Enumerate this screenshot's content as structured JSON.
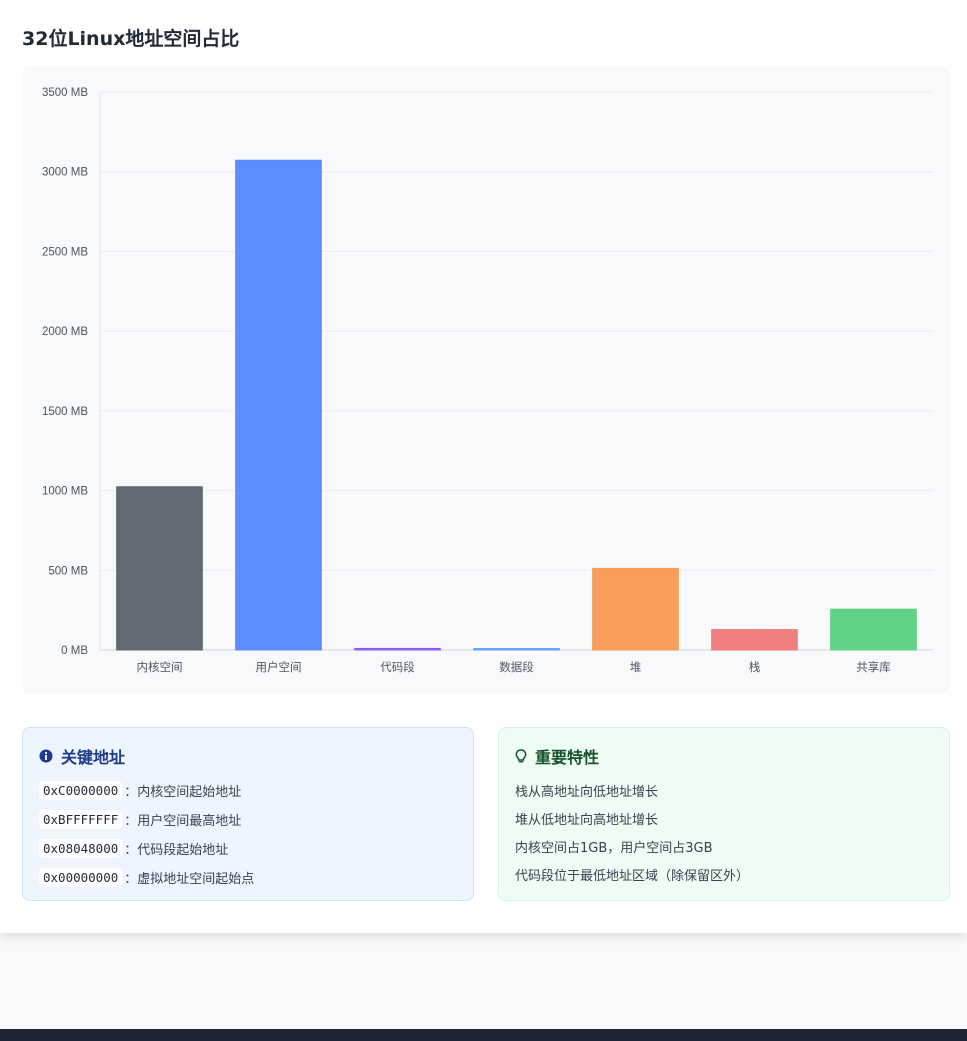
{
  "page": {
    "title": "32位Linux地址空间占比"
  },
  "chart_data": {
    "type": "bar",
    "categories": [
      "内核空间",
      "用户空间",
      "代码段",
      "数据段",
      "堆",
      "栈",
      "共享库"
    ],
    "values": [
      1024,
      3072,
      10,
      5,
      512,
      128,
      256
    ],
    "colors": [
      "#5f6670",
      "#5a8afc",
      "#8b5cf6",
      "#60a5fa",
      "#f79c5a",
      "#f07b7b",
      "#5ed284"
    ],
    "ylim": [
      0,
      3500
    ],
    "yticks": [
      "0 MB",
      "500 MB",
      "1000 MB",
      "1500 MB",
      "2000 MB",
      "2500 MB",
      "3000 MB",
      "3500 MB"
    ],
    "ytick_values": [
      0,
      500,
      1000,
      1500,
      2000,
      2500,
      3000,
      3500
    ],
    "grid": true,
    "legend": "none"
  },
  "key_addresses": {
    "title": "关键地址",
    "icon": "info-circle-icon",
    "items": [
      {
        "code": "0xC0000000",
        "desc": "：内核空间起始地址"
      },
      {
        "code": "0xBFFFFFFF",
        "desc": "：用户空间最高地址"
      },
      {
        "code": "0x08048000",
        "desc": "：代码段起始地址"
      },
      {
        "code": "0x00000000",
        "desc": "：虚拟地址空间起始点"
      }
    ]
  },
  "features": {
    "title": "重要特性",
    "icon": "lightbulb-icon",
    "items": [
      "栈从高地址向低地址增长",
      "堆从低地址向高地址增长",
      "内核空间占1GB，用户空间占3GB",
      "代码段位于最低地址区域（除保留区外）"
    ]
  }
}
